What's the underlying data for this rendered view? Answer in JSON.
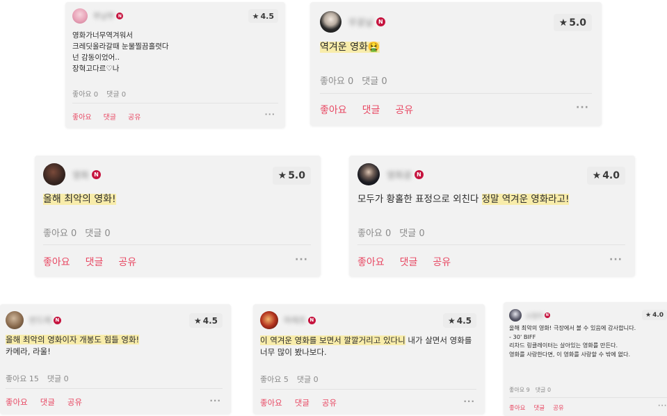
{
  "reviews": [
    {
      "username": "쭈냥쭈",
      "badge": "N",
      "rating": "4.5",
      "lines": [
        [
          "영화가너무역겨워서"
        ],
        [
          "크레딧올라갈때 눈물찔끔흘렷다"
        ],
        [
          "넌 감동이었어.."
        ],
        [
          "장혁고다르♡나"
        ]
      ],
      "likes": "좋아요 0",
      "comments": "댓글 0",
      "actions": [
        "좋아요",
        "댓글",
        "공유"
      ],
      "more": "···",
      "avatar_color": "#e8a3b8"
    },
    {
      "username": "무꽁날",
      "badge": "N",
      "rating": "5.0",
      "lines": [
        [
          "",
          "역겨운 영화🤮"
        ]
      ],
      "likes": "좋아요 0",
      "comments": "댓글 0",
      "actions": [
        "좋아요",
        "댓글",
        "공유"
      ],
      "more": "···",
      "avatar_color": "#2a2a2a"
    },
    {
      "username": "영화",
      "badge": "N",
      "rating": "5.0",
      "lines": [
        [
          "",
          "올해 최악의 영화!"
        ]
      ],
      "likes": "좋아요 0",
      "comments": "댓글 0",
      "actions": [
        "좋아요",
        "댓글",
        "공유"
      ],
      "more": "···",
      "avatar_color": "#3a2722"
    },
    {
      "username": "영화광",
      "badge": "N",
      "rating": "4.0",
      "lines": [
        [
          "모두가 황홀한 표정으로 외친다 ",
          "정말 역겨운 영화라고!"
        ]
      ],
      "likes": "좋아요 0",
      "comments": "댓글 0",
      "actions": [
        "좋아요",
        "댓글",
        "공유"
      ],
      "more": "···",
      "avatar_color": "#1e1e24"
    },
    {
      "username": "반드레",
      "badge": "N",
      "rating": "4.5",
      "lines": [
        [
          "",
          "올해 최악의 영화이자 개봉도 힘들 영화!"
        ],
        [
          "카메라, 라울!"
        ]
      ],
      "likes": "좋아요 15",
      "comments": "댓글 0",
      "actions": [
        "좋아요",
        "댓글",
        "공유"
      ],
      "more": "···",
      "avatar_color": "#8a6b4e"
    },
    {
      "username": "마레프",
      "badge": "N",
      "rating": "4.5",
      "lines": [
        [
          "",
          "이 역겨운 영화를 보면서 깔깔거리고 있다니",
          " 내가 살면서 영화를"
        ],
        [
          "너무 많이 봤나보다."
        ]
      ],
      "likes": "좋아요 5",
      "comments": "댓글 0",
      "actions": [
        "좋아요",
        "댓글",
        "공유"
      ],
      "more": "···",
      "avatar_color": "#b3331f"
    },
    {
      "username": "소밍아",
      "badge": "N",
      "rating": "4.0",
      "lines": [
        [
          "올해 최악의 영화! 극장에서 볼 수 있음에 감사합니다."
        ],
        [
          "- 30' BIFF"
        ],
        [
          " "
        ],
        [
          "리차드 링클레이터는 살아있는 영화를 만든다."
        ],
        [
          "영화를 사랑한다면, 이 영화를 사랑할 수 밖에 없다."
        ]
      ],
      "likes": "좋아요 9",
      "comments": "댓글 0",
      "actions": [
        "좋아요",
        "댓글",
        "공유"
      ],
      "more": "···",
      "avatar_color": "#5b5b6b"
    }
  ]
}
